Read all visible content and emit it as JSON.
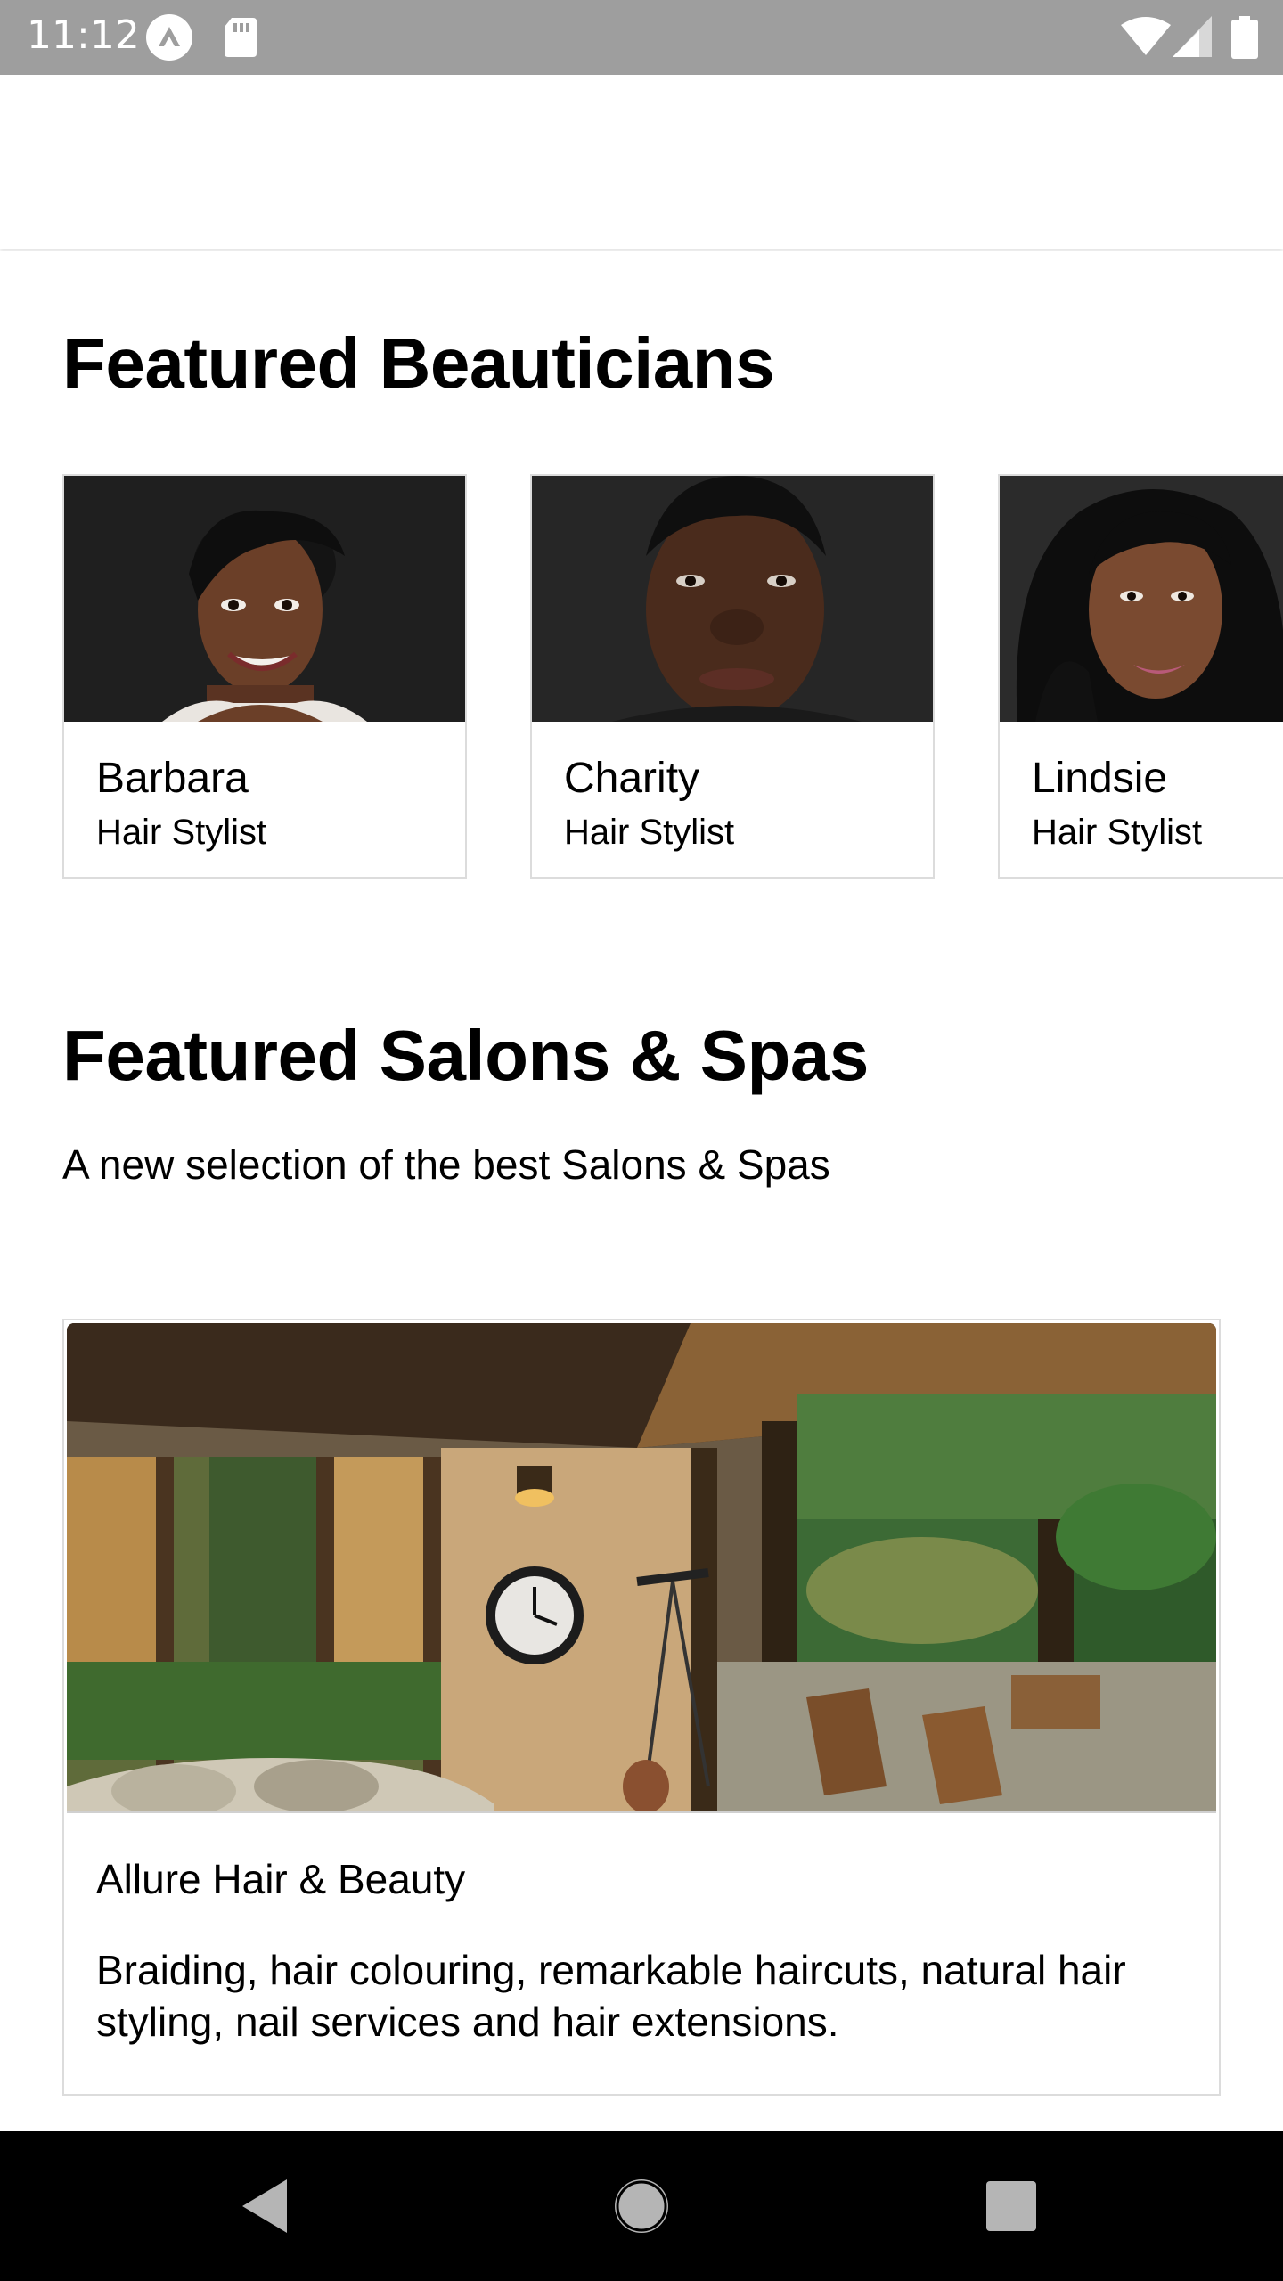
{
  "status_bar": {
    "time": "11:12",
    "left_icons": [
      "app-notification-icon",
      "sd-card-icon"
    ],
    "right_icons": [
      "wifi-icon",
      "cellular-signal-icon",
      "battery-icon"
    ]
  },
  "featured_beauticians": {
    "title": "Featured Beauticians",
    "items": [
      {
        "name": "Barbara",
        "role": "Hair Stylist"
      },
      {
        "name": "Charity",
        "role": "Hair Stylist"
      },
      {
        "name": "Lindsie",
        "role": "Hair Stylist"
      }
    ]
  },
  "featured_salons": {
    "title": "Featured Salons & Spas",
    "subtitle": "A new selection of the best Salons & Spas",
    "items": [
      {
        "name": "Allure Hair & Beauty",
        "description": "Braiding, hair colouring, remarkable haircuts, natural hair styling, nail services and hair extensions."
      }
    ]
  },
  "nav_bar": {
    "icons": [
      "back-icon",
      "home-icon",
      "recents-icon"
    ]
  },
  "colors": {
    "status_bar": "#9e9e9e",
    "nav_bar": "#000000",
    "card_border": "#dcdcdc"
  }
}
